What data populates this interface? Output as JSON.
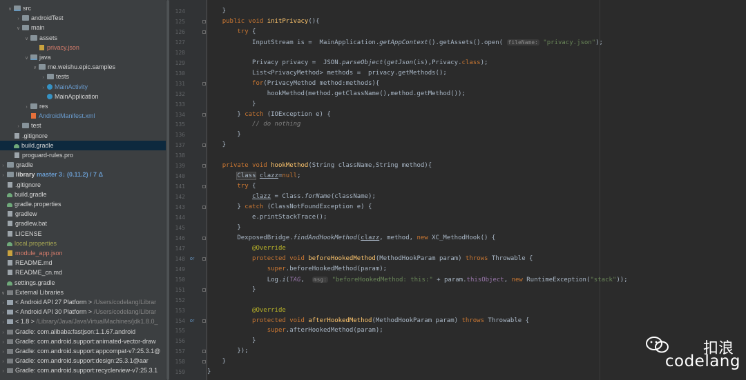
{
  "project_tree": [
    {
      "indent": 0,
      "arrow": "v",
      "icon": "folder-src",
      "label": "src",
      "color": "white"
    },
    {
      "indent": 1,
      "arrow": ">",
      "icon": "folder",
      "label": "androidTest",
      "color": "white"
    },
    {
      "indent": 1,
      "arrow": "v",
      "icon": "folder",
      "label": "main",
      "color": "white"
    },
    {
      "indent": 2,
      "arrow": "v",
      "icon": "folder",
      "label": "assets",
      "color": "white"
    },
    {
      "indent": 3,
      "arrow": "",
      "icon": "json",
      "label": "privacy.json",
      "color": "red"
    },
    {
      "indent": 2,
      "arrow": "v",
      "icon": "folder-src",
      "label": "java",
      "color": "white"
    },
    {
      "indent": 3,
      "arrow": "v",
      "icon": "pkg",
      "label": "me.weishu.epic.samples",
      "color": "white"
    },
    {
      "indent": 4,
      "arrow": ">",
      "icon": "pkg",
      "label": "tests",
      "color": "white"
    },
    {
      "indent": 4,
      "arrow": ">",
      "icon": "cls",
      "label": "MainActivity",
      "color": "blue"
    },
    {
      "indent": 4,
      "arrow": "",
      "icon": "cls",
      "label": "MainApplication",
      "color": "white"
    },
    {
      "indent": 2,
      "arrow": ">",
      "icon": "folder",
      "label": "res",
      "color": "white"
    },
    {
      "indent": 2,
      "arrow": "",
      "icon": "xml",
      "label": "AndroidManifest.xml",
      "color": "blue"
    },
    {
      "indent": 1,
      "arrow": ">",
      "icon": "folder",
      "label": "test",
      "color": "white"
    },
    {
      "indent": 0,
      "arrow": "",
      "icon": "file",
      "label": ".gitignore",
      "color": "white"
    },
    {
      "indent": 0,
      "arrow": "",
      "icon": "gradle",
      "label": "build.gradle",
      "color": "white",
      "selected": true
    },
    {
      "indent": 0,
      "arrow": "",
      "icon": "file",
      "label": "proguard-rules.pro",
      "color": "white"
    },
    {
      "indent": -1,
      "arrow": ">",
      "icon": "folder",
      "label": "gradle",
      "color": "white"
    },
    {
      "indent": -1,
      "arrow": ">",
      "icon": "folder",
      "label": "library",
      "color": "bold",
      "suffix": "master 3↓ (0.11.2) / 7 Δ"
    },
    {
      "indent": -1,
      "arrow": "",
      "icon": "file",
      "label": ".gitignore",
      "color": "white"
    },
    {
      "indent": -1,
      "arrow": "",
      "icon": "gradle",
      "label": "build.gradle",
      "color": "white"
    },
    {
      "indent": -1,
      "arrow": "",
      "icon": "gradle",
      "label": "gradle.properties",
      "color": "white"
    },
    {
      "indent": -1,
      "arrow": "",
      "icon": "file",
      "label": "gradlew",
      "color": "white"
    },
    {
      "indent": -1,
      "arrow": "",
      "icon": "file",
      "label": "gradlew.bat",
      "color": "white"
    },
    {
      "indent": -1,
      "arrow": "",
      "icon": "file",
      "label": "LICENSE",
      "color": "white"
    },
    {
      "indent": -1,
      "arrow": "",
      "icon": "gradle",
      "label": "local.properties",
      "color": "olive"
    },
    {
      "indent": -1,
      "arrow": "",
      "icon": "json",
      "label": "module_app.json",
      "color": "red"
    },
    {
      "indent": -1,
      "arrow": "",
      "icon": "file",
      "label": "README.md",
      "color": "white"
    },
    {
      "indent": -1,
      "arrow": "",
      "icon": "file",
      "label": "README_cn.md",
      "color": "white"
    },
    {
      "indent": -1,
      "arrow": "",
      "icon": "gradle",
      "label": "settings.gradle",
      "color": "white"
    },
    {
      "indent": -2,
      "arrow": "v",
      "icon": "lib",
      "label": "External Libraries",
      "color": "white"
    },
    {
      "indent": -1,
      "arrow": ">",
      "icon": "jdk",
      "label": "< Android API 27 Platform >",
      "color": "white",
      "suffix": "/Users/codelang/Librar"
    },
    {
      "indent": -1,
      "arrow": ">",
      "icon": "jdk",
      "label": "< Android API 30 Platform >",
      "color": "white",
      "suffix": "/Users/codelang/Librar"
    },
    {
      "indent": -1,
      "arrow": ">",
      "icon": "jdk",
      "label": "< 1.8 >",
      "color": "white",
      "suffix": "/Library/Java/JavaVirtualMachines/jdk1.8.0_"
    },
    {
      "indent": -1,
      "arrow": ">",
      "icon": "lib",
      "label": "Gradle: com.alibaba:fastjson:1.1.67.android",
      "color": "white"
    },
    {
      "indent": -1,
      "arrow": ">",
      "icon": "lib",
      "label": "Gradle: com.android.support:animated-vector-draw",
      "color": "white"
    },
    {
      "indent": -1,
      "arrow": ">",
      "icon": "lib",
      "label": "Gradle: com.android.support:appcompat-v7:25.3.1@",
      "color": "white"
    },
    {
      "indent": -1,
      "arrow": ">",
      "icon": "lib",
      "label": "Gradle: com.android.support:design:25.3.1@aar",
      "color": "white"
    },
    {
      "indent": -1,
      "arrow": ">",
      "icon": "lib",
      "label": "Gradle: com.android.support:recyclerview-v7:25.3.1",
      "color": "white"
    }
  ],
  "code_lines": [
    {
      "n": "124",
      "html": "    }"
    },
    {
      "n": "125",
      "html": "    <span class=\"kw\">public void </span><span class=\"fn\">initPrivacy</span>(){"
    },
    {
      "n": "126",
      "html": "        <span class=\"kw\">try </span>{"
    },
    {
      "n": "127",
      "html": "            InputStream is =  MainApplication.<span class=\"st\">getAppContext</span>().getAssets().open( <span class=\"hint\">fileName:</span> <span class=\"str\">\"privacy.json\"</span>);"
    },
    {
      "n": "128",
      "html": ""
    },
    {
      "n": "129",
      "html": "            Privacy privacy =  JSON.<span class=\"st\">parseObject</span>(<span class=\"st\">getJson</span>(is),Privacy.<span class=\"kw\">class</span>);"
    },
    {
      "n": "130",
      "html": "            List&lt;PrivacyMethod&gt; methods =  privacy.getMethods();"
    },
    {
      "n": "131",
      "html": "            <span class=\"kw\">for</span>(PrivacyMethod method:methods){"
    },
    {
      "n": "132",
      "html": "                hookMethod(method.getClassName(),method.getMethod());"
    },
    {
      "n": "133",
      "html": "            }"
    },
    {
      "n": "134",
      "html": "        } <span class=\"kw\">catch </span>(IOException e) {"
    },
    {
      "n": "135",
      "html": "            <span class=\"com\">// do nothing</span>"
    },
    {
      "n": "136",
      "html": "        }"
    },
    {
      "n": "137",
      "html": "    }"
    },
    {
      "n": "138",
      "html": ""
    },
    {
      "n": "139",
      "html": "    <span class=\"kw\">private void </span><span class=\"fn\">hookMethod</span>(String className,String method){"
    },
    {
      "n": "140",
      "html": "        <span class=\"hl\">Class</span> <span class=\"underline\">clazz</span>=<span class=\"kw\">null</span>;"
    },
    {
      "n": "141",
      "html": "        <span class=\"kw\">try </span>{"
    },
    {
      "n": "142",
      "html": "            <span class=\"underline\">clazz</span> = Class.<span class=\"st\">forName</span>(className);"
    },
    {
      "n": "143",
      "html": "        } <span class=\"kw\">catch </span>(ClassNotFoundException e) {"
    },
    {
      "n": "144",
      "html": "            e.printStackTrace();"
    },
    {
      "n": "145",
      "html": "        }"
    },
    {
      "n": "146",
      "html": "        DexposedBridge.<span class=\"st\">findAndHookMethod</span>(<span class=\"underline\">clazz</span>, method, <span class=\"kw\">new </span>XC_MethodHook() {"
    },
    {
      "n": "147",
      "html": "            <span class=\"ann\">@Override</span>"
    },
    {
      "n": "148",
      "html": "            <span class=\"kw\">protected void </span><span class=\"fn\">beforeHookedMethod</span>(MethodHookParam param) <span class=\"kw\">throws </span>Throwable {"
    },
    {
      "n": "149",
      "html": "                <span class=\"kw\">super</span>.beforeHookedMethod(param);"
    },
    {
      "n": "150",
      "html": "                Log.<span class=\"st\">i</span>(<span class=\"stf\">TAG</span>,  <span class=\"hint\">msg:</span> <span class=\"str\">\"beforeHookedMethod: this:\"</span> + param.<span class=\"field\">thisObject</span>, <span class=\"kw\">new </span>RuntimeException(<span class=\"str\">\"stack\"</span>));"
    },
    {
      "n": "151",
      "html": "            }"
    },
    {
      "n": "152",
      "html": ""
    },
    {
      "n": "153",
      "html": "            <span class=\"ann\">@Override</span>"
    },
    {
      "n": "154",
      "html": "            <span class=\"kw\">protected void </span><span class=\"fn\">afterHookedMethod</span>(MethodHookParam param) <span class=\"kw\">throws </span>Throwable {"
    },
    {
      "n": "155",
      "html": "                <span class=\"kw\">super</span>.afterHookedMethod(param);"
    },
    {
      "n": "156",
      "html": "            }"
    },
    {
      "n": "157",
      "html": "        });"
    },
    {
      "n": "158",
      "html": "    }"
    },
    {
      "n": "159",
      "html": "}"
    }
  ],
  "gutter_markers": {
    "148": "o↑",
    "154": "o↑"
  },
  "watermark": {
    "title": "扣浪",
    "subtitle": "codelang"
  },
  "colors": {
    "keyword": "#cc7832",
    "function": "#ffc66d",
    "string": "#6a8759",
    "comment": "#808080",
    "annotation": "#bbb529",
    "field": "#9876aa"
  }
}
